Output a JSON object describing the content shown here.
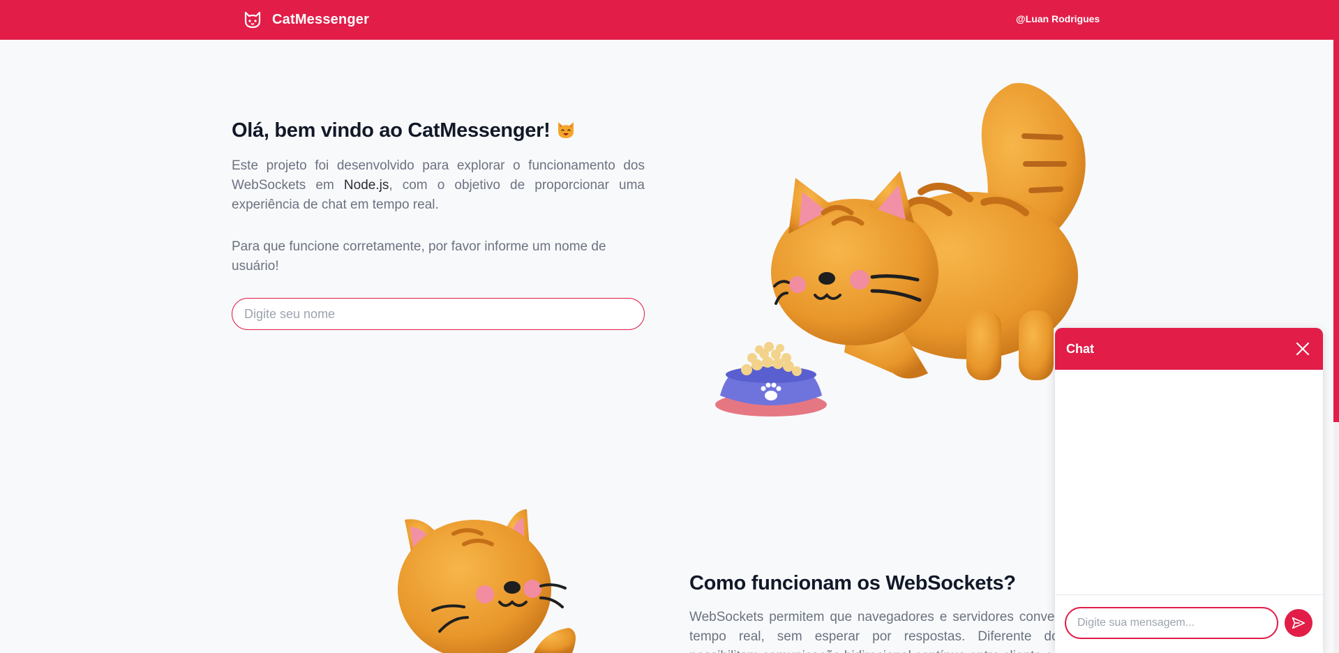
{
  "header": {
    "brand_name": "CatMessenger",
    "brand_icon": "cat-face-icon",
    "user_handle": "@Luan Rodrigues"
  },
  "hero": {
    "title": "Olá, bem vindo ao CatMessenger!",
    "title_emoji": "cat-emoji-icon",
    "paragraph1_part1": "Este projeto foi desenvolvido para explorar o funcionamento dos WebSockets em ",
    "paragraph1_strong": "Node.js",
    "paragraph1_part2": ", com o objetivo de proporcionar uma experiência de chat em tempo real.",
    "paragraph2": "Para que funcione corretamente, por favor informe um nome de usuário!",
    "name_placeholder": "Digite seu nome"
  },
  "section2": {
    "title": "Como funcionam os WebSockets?",
    "paragraph": "WebSockets permitem que navegadores e servidores conversem em tempo real, sem esperar por respostas. Diferente do HTTP, possibilitam comunicação bidirecional contínua entre cliente e servidor."
  },
  "chat": {
    "title": "Chat",
    "close_icon": "close-icon",
    "message_placeholder": "Digite sua mensagem...",
    "send_icon": "send-icon"
  },
  "colors": {
    "accent": "#e11d48",
    "background": "#f8f9fb"
  }
}
